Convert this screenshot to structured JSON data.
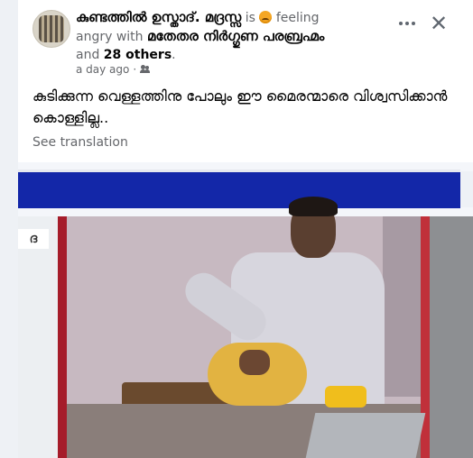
{
  "post": {
    "author": "കുണ്ടത്തിൽ ഉസ്താദ്. മദ്രസ്സ",
    "is_text": " is ",
    "feeling_text": " feeling",
    "angry_with": "angry with ",
    "tagged_name": "മതേതര നിർഗ്ഗുണ പരബ്രഹ്മം",
    "and_text": "and ",
    "others": "28 others",
    "period": ".",
    "timestamp": "a day ago",
    "separator": " · ",
    "body": "കുടിക്കുന്ന വെള്ളത്തിനു പോലും ഈ മൈരന്മാരെ വിശ്വസിക്കാൻ കൊള്ളില്ല..",
    "see_translation": "See translation",
    "close_symbol": "✕"
  },
  "video": {
    "label": "ദ"
  },
  "icons": {
    "feeling": "angry-face-emoji",
    "audience": "friends-icon",
    "more": "more-options-icon",
    "close": "close-icon"
  },
  "colors": {
    "background": "#eef1f5",
    "card": "#ffffff",
    "text_primary": "#050505",
    "text_secondary": "#65676b",
    "broadcast_blue": "#1327a8"
  }
}
